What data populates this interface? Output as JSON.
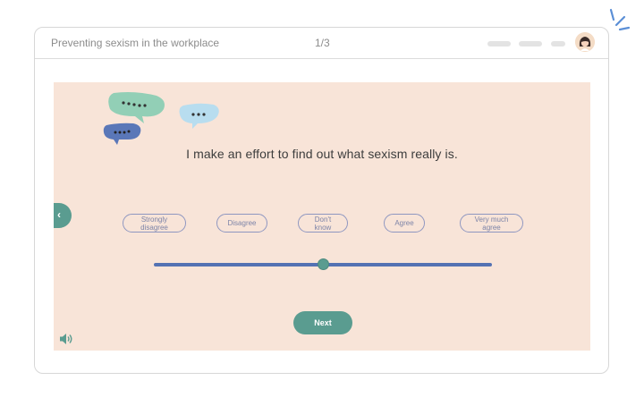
{
  "header": {
    "course_title": "Preventing sexism in the workplace",
    "page_counter": "1/3"
  },
  "question": {
    "statement": "I make an effort to find out what sexism really is."
  },
  "scale": {
    "options": [
      {
        "line1": "Strongly",
        "line2": "disagree"
      },
      {
        "line1": "Disagree",
        "line2": ""
      },
      {
        "line1": "Don't",
        "line2": "know"
      },
      {
        "line1": "Agree",
        "line2": ""
      },
      {
        "line1": "Very much",
        "line2": "agree"
      }
    ],
    "slider_value": 0.5
  },
  "buttons": {
    "next_label": "Next"
  },
  "icons": {
    "back": "chevron-left-icon",
    "sound": "speaker-icon",
    "avatar": "user-avatar",
    "decoration": "speech-bubbles-icon"
  },
  "colors": {
    "accent": "#5a9c90",
    "slider_track": "#5472b3",
    "stage_background": "#f8e4d8",
    "option_border": "#8e96c0"
  }
}
